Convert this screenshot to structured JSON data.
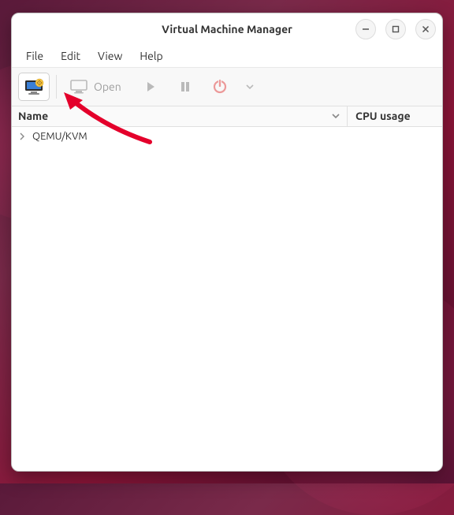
{
  "window": {
    "title": "Virtual Machine Manager"
  },
  "menubar": {
    "items": [
      "File",
      "Edit",
      "View",
      "Help"
    ]
  },
  "toolbar": {
    "open_label": "Open"
  },
  "columns": {
    "name": "Name",
    "cpu": "CPU usage"
  },
  "tree": {
    "rows": [
      {
        "label": "QEMU/KVM"
      }
    ]
  },
  "colors": {
    "power_red": "#e44d4d",
    "accent_icon_blue": "#3a7fd5",
    "accent_icon_yellow": "#f5c542"
  }
}
